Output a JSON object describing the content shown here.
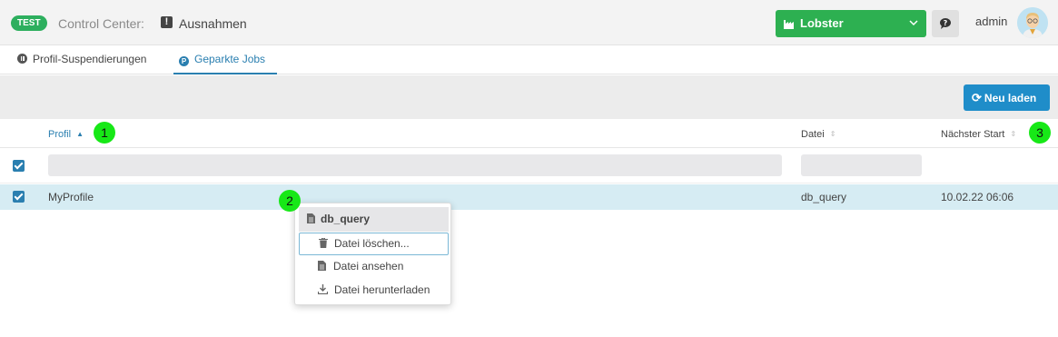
{
  "header": {
    "env_badge": "TEST",
    "app_prefix": "Control Center:",
    "page_name": "Ausnahmen",
    "tenant": "Lobster",
    "user": "admin"
  },
  "tabs": [
    {
      "label": "Profil-Suspendierungen",
      "active": false
    },
    {
      "label": "Geparkte Jobs",
      "active": true
    }
  ],
  "toolbar": {
    "reload_label": "Neu laden"
  },
  "table": {
    "columns": [
      {
        "label": "Profil",
        "sort": "asc"
      },
      {
        "label": "Datei",
        "sort": "none"
      },
      {
        "label": "Nächster Start",
        "sort": "none"
      }
    ],
    "filters": {
      "profile": "",
      "file": ""
    },
    "rows": [
      {
        "profile": "MyProfile",
        "file": "db_query",
        "next_start": "10.02.22 06:06",
        "selected": true
      }
    ]
  },
  "context_menu": {
    "title": "db_query",
    "items": [
      {
        "label": "Datei löschen...",
        "icon": "trash-icon",
        "focused": true
      },
      {
        "label": "Datei ansehen",
        "icon": "document-icon",
        "focused": false
      },
      {
        "label": "Datei herunterladen",
        "icon": "download-icon",
        "focused": false
      }
    ]
  },
  "markers": [
    "1",
    "2",
    "3"
  ],
  "colors": {
    "accent": "#2a7fb0",
    "tenant": "#2db051",
    "env": "#2daf5e",
    "row_selected": "#d6ecf3",
    "marker": "#17e817"
  }
}
